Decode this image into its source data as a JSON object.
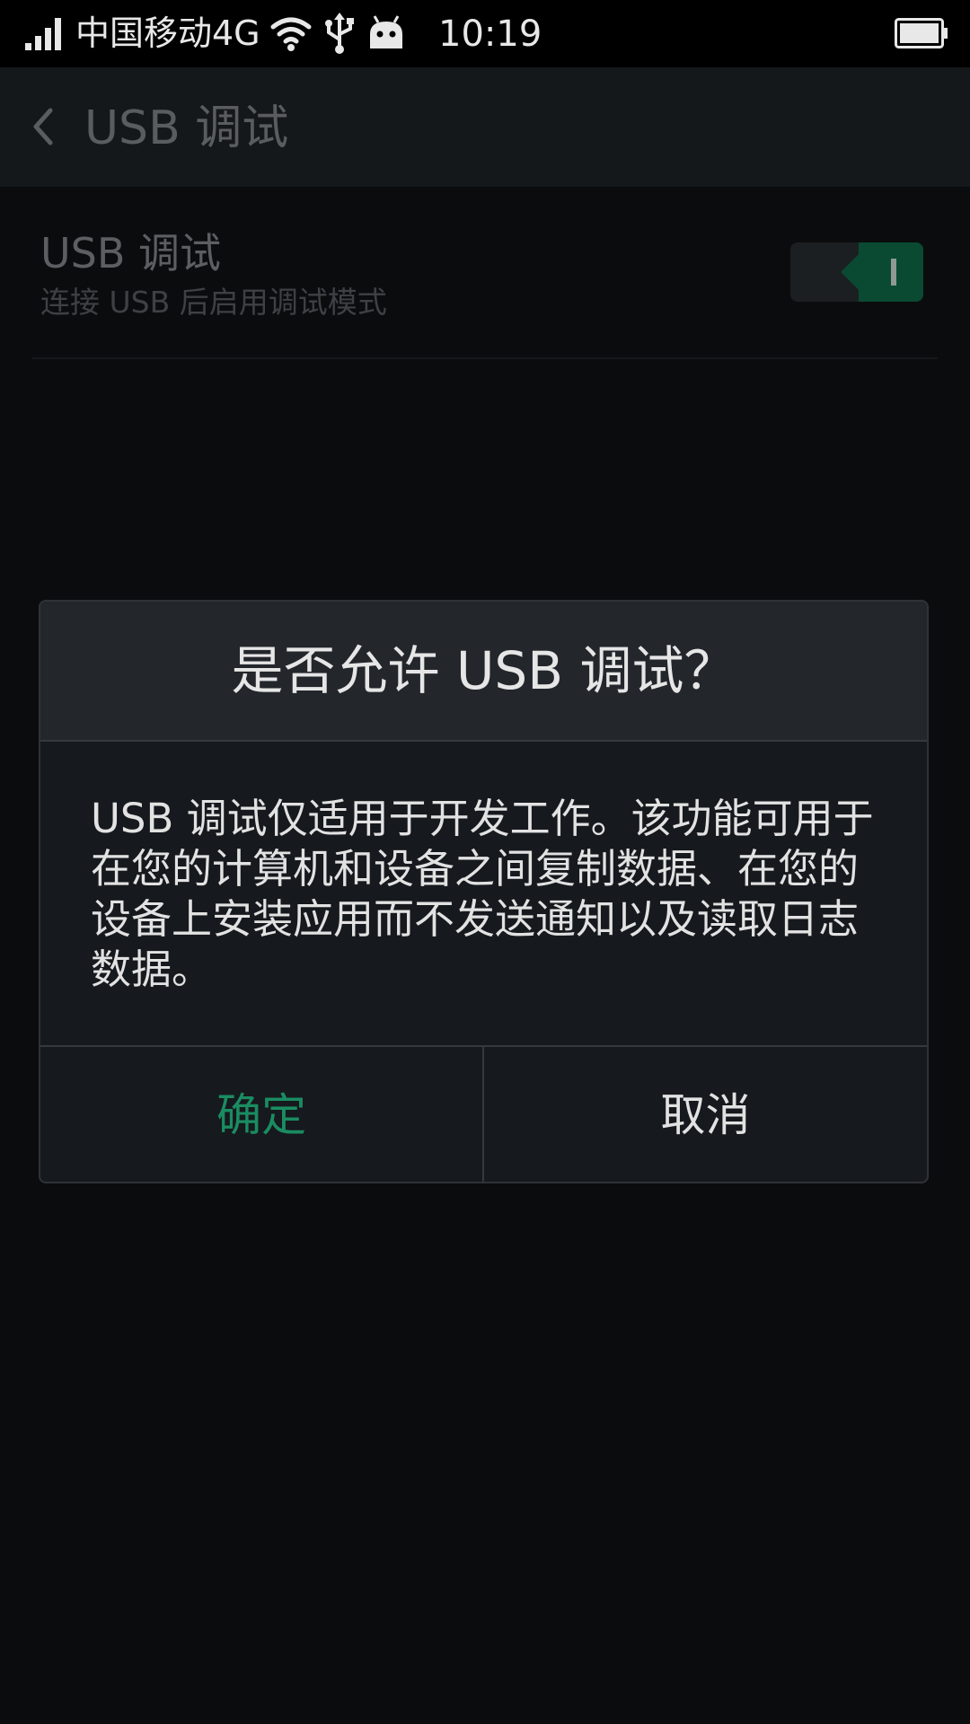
{
  "status_bar": {
    "carrier": "中国移动4G",
    "time": "10:19",
    "icons": [
      "signal-icon",
      "wifi-icon",
      "usb-icon",
      "android-icon",
      "battery-icon"
    ]
  },
  "header": {
    "title": "USB 调试"
  },
  "setting": {
    "title": "USB 调试",
    "subtitle": "连接 USB 后启用调试模式",
    "toggle_on": true
  },
  "dialog": {
    "title": "是否允许 USB 调试？",
    "message": "USB 调试仅适用于开发工作。该功能可用于在您的计算机和设备之间复制数据、在您的设备上安装应用而不发送通知以及读取日志数据。",
    "confirm_label": "确定",
    "cancel_label": "取消"
  },
  "colors": {
    "accent": "#1a8c62",
    "toggle_on": "#0a4a33",
    "background": "#0b0c0e",
    "dialog_bg": "#16191d",
    "dialog_header_bg": "#23272c"
  }
}
